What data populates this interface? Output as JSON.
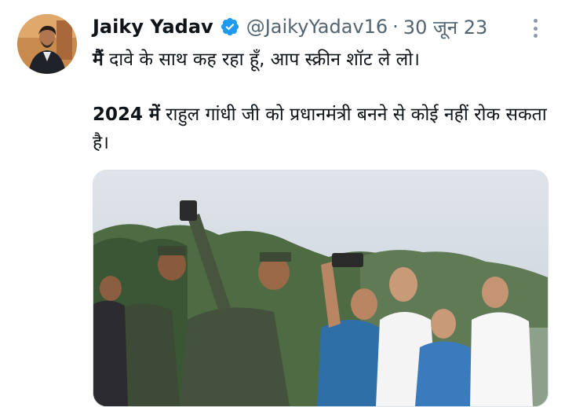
{
  "tweet": {
    "author": {
      "name": "Jaiky Yadav",
      "handle": "@JaikyYadav16",
      "verified": true
    },
    "separator": "·",
    "date": "30 जून 23",
    "text": {
      "line1_bold": "मैं",
      "line1_rest": " दावे के साथ कह रहा हूँ, आप स्क्रीन शॉट ले लो।",
      "line2_bold": "2024 में",
      "line2_rest": " राहुल गांधी जी को प्रधानमंत्री बनने से कोई नहीं रोक सकता है।"
    },
    "icons": {
      "verified": "verified-badge-icon",
      "more": "more-options-icon"
    },
    "colors": {
      "verified_blue": "#1d9bf0",
      "secondary_text": "#536471",
      "primary_text": "#0f1419"
    }
  }
}
